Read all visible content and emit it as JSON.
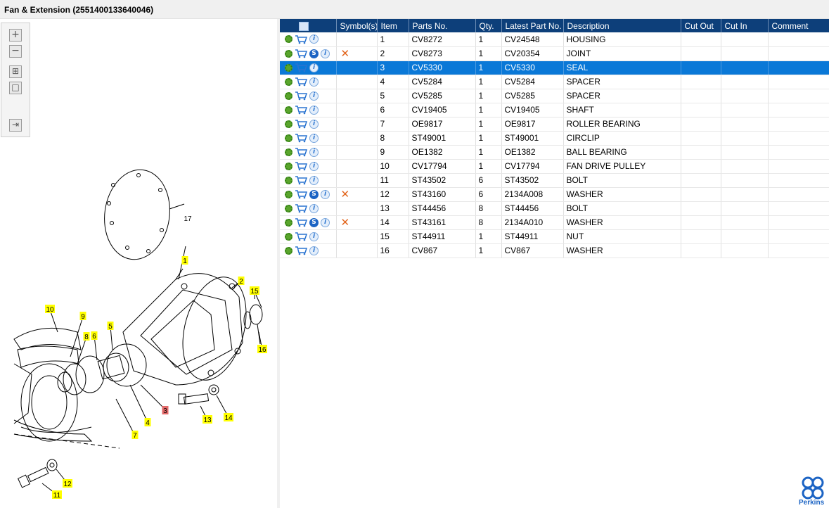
{
  "window": {
    "title": "Fan & Extension (2551400133640046)"
  },
  "toolbox": {
    "zoom_in": "+",
    "zoom_out": "−",
    "fit_all": "⊞",
    "fit_page": "□",
    "export": "⇥"
  },
  "diagram": {
    "callouts": [
      {
        "label": "1",
        "color": "#ffff00"
      },
      {
        "label": "2",
        "color": "#ffff00"
      },
      {
        "label": "3",
        "color": "#e46a6a"
      },
      {
        "label": "4",
        "color": "#ffff00"
      },
      {
        "label": "5",
        "color": "#ffff00"
      },
      {
        "label": "6",
        "color": "#ffff00"
      },
      {
        "label": "7",
        "color": "#ffff00"
      },
      {
        "label": "8",
        "color": "#ffff00"
      },
      {
        "label": "9",
        "color": "#ffff00"
      },
      {
        "label": "10",
        "color": "#ffff00"
      },
      {
        "label": "11",
        "color": "#ffff00"
      },
      {
        "label": "12",
        "color": "#ffff00"
      },
      {
        "label": "13",
        "color": "#ffff00"
      },
      {
        "label": "14",
        "color": "#ffff00"
      },
      {
        "label": "15",
        "color": "#ffff00"
      },
      {
        "label": "16",
        "color": "#ffff00"
      },
      {
        "label": "17",
        "color": "none"
      }
    ]
  },
  "table": {
    "headers": [
      "",
      "Symbol(s)",
      "Item",
      "Parts No.",
      "Qty.",
      "Latest Part No.",
      "Description",
      "Cut Out",
      "Cut In",
      "Comment"
    ],
    "selected_item": "3",
    "rows": [
      {
        "item": "1",
        "parts_no": "CV8272",
        "qty": "1",
        "latest": "CV24548",
        "desc": "HOUSING",
        "s_icon": false,
        "symbol_x": false
      },
      {
        "item": "2",
        "parts_no": "CV8273",
        "qty": "1",
        "latest": "CV20354",
        "desc": "JOINT",
        "s_icon": true,
        "symbol_x": true
      },
      {
        "item": "3",
        "parts_no": "CV5330",
        "qty": "1",
        "latest": "CV5330",
        "desc": "SEAL",
        "s_icon": false,
        "symbol_x": false
      },
      {
        "item": "4",
        "parts_no": "CV5284",
        "qty": "1",
        "latest": "CV5284",
        "desc": "SPACER",
        "s_icon": false,
        "symbol_x": false
      },
      {
        "item": "5",
        "parts_no": "CV5285",
        "qty": "1",
        "latest": "CV5285",
        "desc": "SPACER",
        "s_icon": false,
        "symbol_x": false
      },
      {
        "item": "6",
        "parts_no": "CV19405",
        "qty": "1",
        "latest": "CV19405",
        "desc": "SHAFT",
        "s_icon": false,
        "symbol_x": false
      },
      {
        "item": "7",
        "parts_no": "OE9817",
        "qty": "1",
        "latest": "OE9817",
        "desc": "ROLLER BEARING",
        "s_icon": false,
        "symbol_x": false
      },
      {
        "item": "8",
        "parts_no": "ST49001",
        "qty": "1",
        "latest": "ST49001",
        "desc": "CIRCLIP",
        "s_icon": false,
        "symbol_x": false
      },
      {
        "item": "9",
        "parts_no": "OE1382",
        "qty": "1",
        "latest": "OE1382",
        "desc": "BALL BEARING",
        "s_icon": false,
        "symbol_x": false
      },
      {
        "item": "10",
        "parts_no": "CV17794",
        "qty": "1",
        "latest": "CV17794",
        "desc": "FAN DRIVE PULLEY",
        "s_icon": false,
        "symbol_x": false
      },
      {
        "item": "11",
        "parts_no": "ST43502",
        "qty": "6",
        "latest": "ST43502",
        "desc": "BOLT",
        "s_icon": false,
        "symbol_x": false
      },
      {
        "item": "12",
        "parts_no": "ST43160",
        "qty": "6",
        "latest": "2134A008",
        "desc": "WASHER",
        "s_icon": true,
        "symbol_x": true
      },
      {
        "item": "13",
        "parts_no": "ST44456",
        "qty": "8",
        "latest": "ST44456",
        "desc": "BOLT",
        "s_icon": false,
        "symbol_x": false
      },
      {
        "item": "14",
        "parts_no": "ST43161",
        "qty": "8",
        "latest": "2134A010",
        "desc": "WASHER",
        "s_icon": true,
        "symbol_x": true
      },
      {
        "item": "15",
        "parts_no": "ST44911",
        "qty": "1",
        "latest": "ST44911",
        "desc": "NUT",
        "s_icon": false,
        "symbol_x": false
      },
      {
        "item": "16",
        "parts_no": "CV867",
        "qty": "1",
        "latest": "CV867",
        "desc": "WASHER",
        "s_icon": false,
        "symbol_x": false
      }
    ]
  },
  "logo": {
    "text": "Perkins"
  },
  "colors": {
    "header_bg": "#0d3f7a",
    "selected_row": "#0a78d7",
    "callout_yellow": "#ffff00",
    "callout_selected": "#e46a6a",
    "symbol_x": "#e2661e"
  }
}
